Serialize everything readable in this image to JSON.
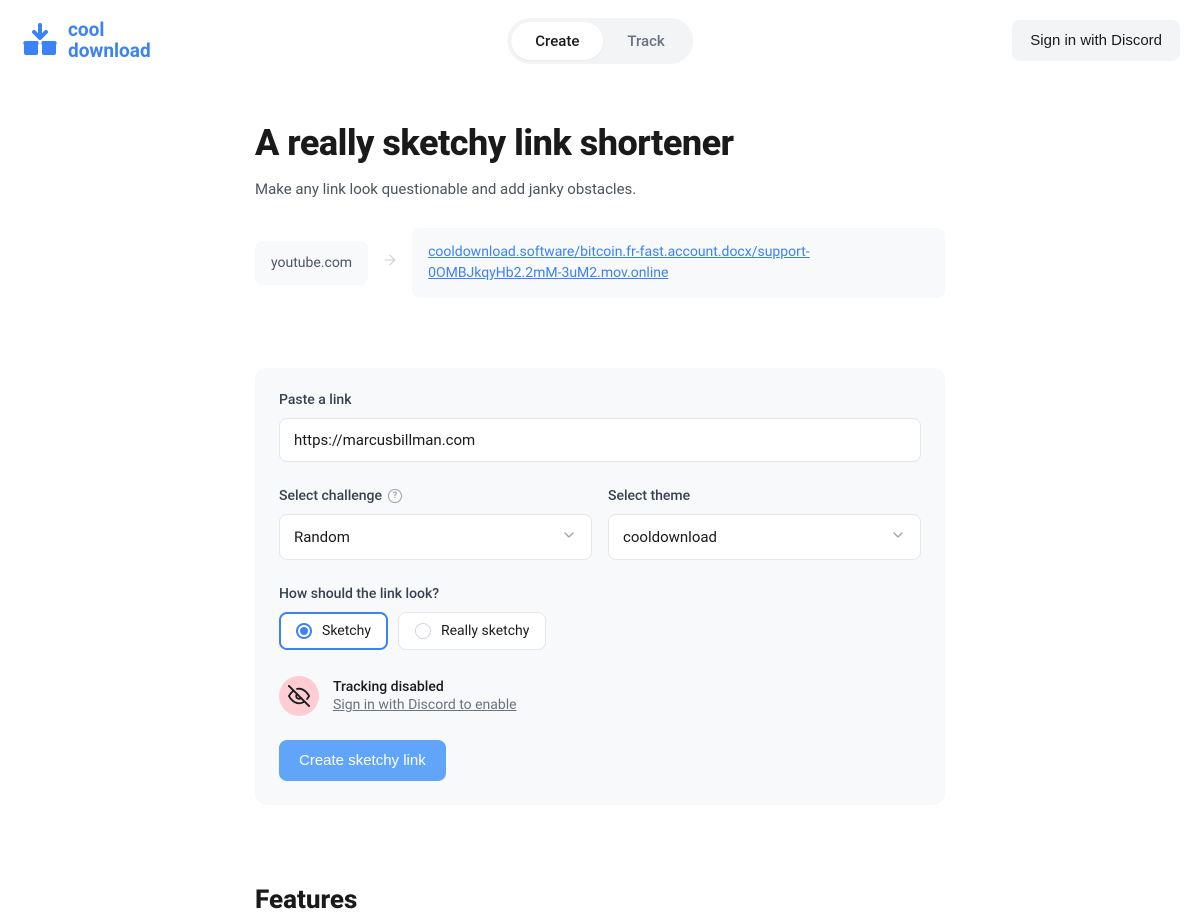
{
  "header": {
    "logo_line1": "cool",
    "logo_line2": "download",
    "tabs": [
      {
        "label": "Create",
        "active": true
      },
      {
        "label": "Track",
        "active": false
      }
    ],
    "signin_label": "Sign in with Discord"
  },
  "hero": {
    "title": "A really sketchy link shortener",
    "subtitle": "Make any link look questionable and add janky obstacles."
  },
  "example": {
    "src": "youtube.com",
    "dst": "cooldownload.software/bitcoin.fr-fast.account.docx/support-0OMBJkqyHb2.2mM-3uM2.mov.online"
  },
  "form": {
    "paste_label": "Paste a link",
    "paste_value": "https://marcusbillman.com",
    "challenge_label": "Select challenge",
    "challenge_value": "Random",
    "theme_label": "Select theme",
    "theme_value": "cooldownload",
    "look_label": "How should the link look?",
    "look_options": [
      {
        "label": "Sketchy",
        "selected": true
      },
      {
        "label": "Really sketchy",
        "selected": false
      }
    ],
    "tracking": {
      "title": "Tracking disabled",
      "link": "Sign in with Discord to enable"
    },
    "create_label": "Create sketchy link"
  },
  "features": {
    "title": "Features"
  },
  "colors": {
    "accent": "#3b82f6"
  }
}
